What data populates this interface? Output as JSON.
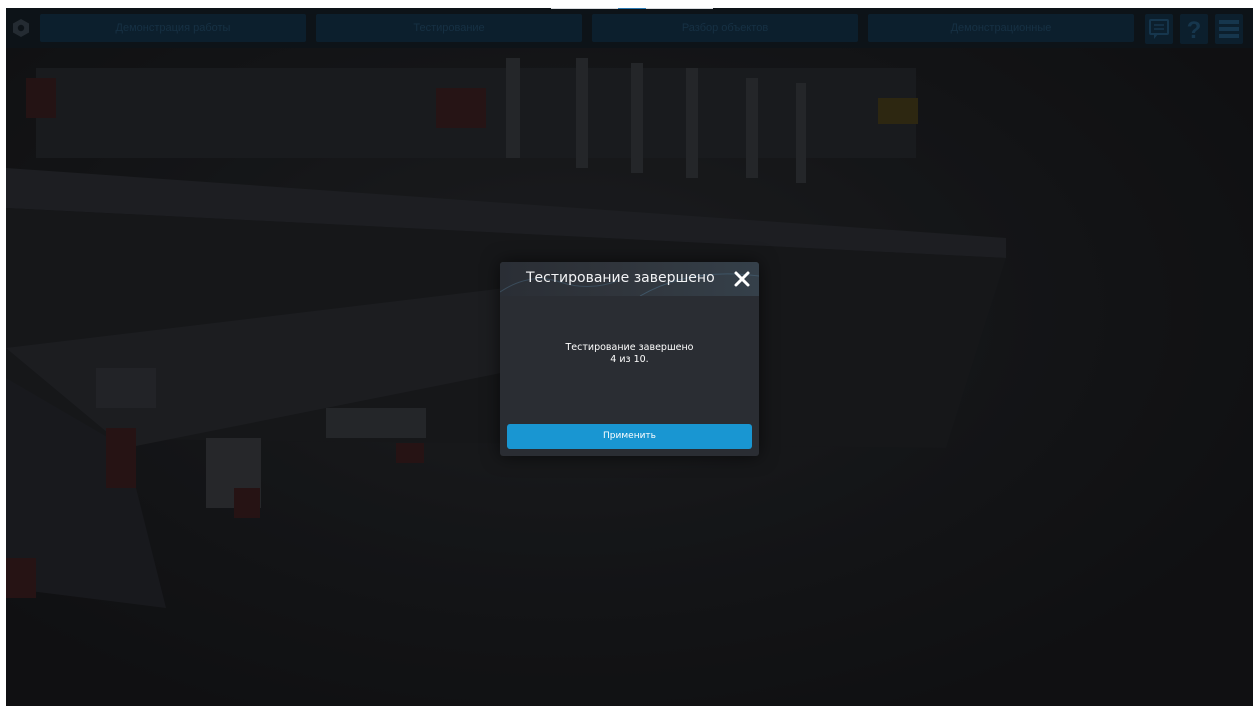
{
  "nav": {
    "tabs": [
      {
        "label": "Демонстрация работы"
      },
      {
        "label": "Тестирование"
      },
      {
        "label": "Разбор объектов"
      },
      {
        "label": "Демонстрационные"
      }
    ],
    "tools": [
      "chat-icon",
      "help-icon",
      "menu-icon"
    ]
  },
  "dialog": {
    "title": "Тестирование завершено",
    "message_line1": "Тестирование завершено",
    "message_line2": "4 из 10.",
    "apply_label": "Применить"
  },
  "colors": {
    "accent": "#1996d2",
    "nav_tab": "#0e3048",
    "dialog_bg": "#2a2d33"
  }
}
